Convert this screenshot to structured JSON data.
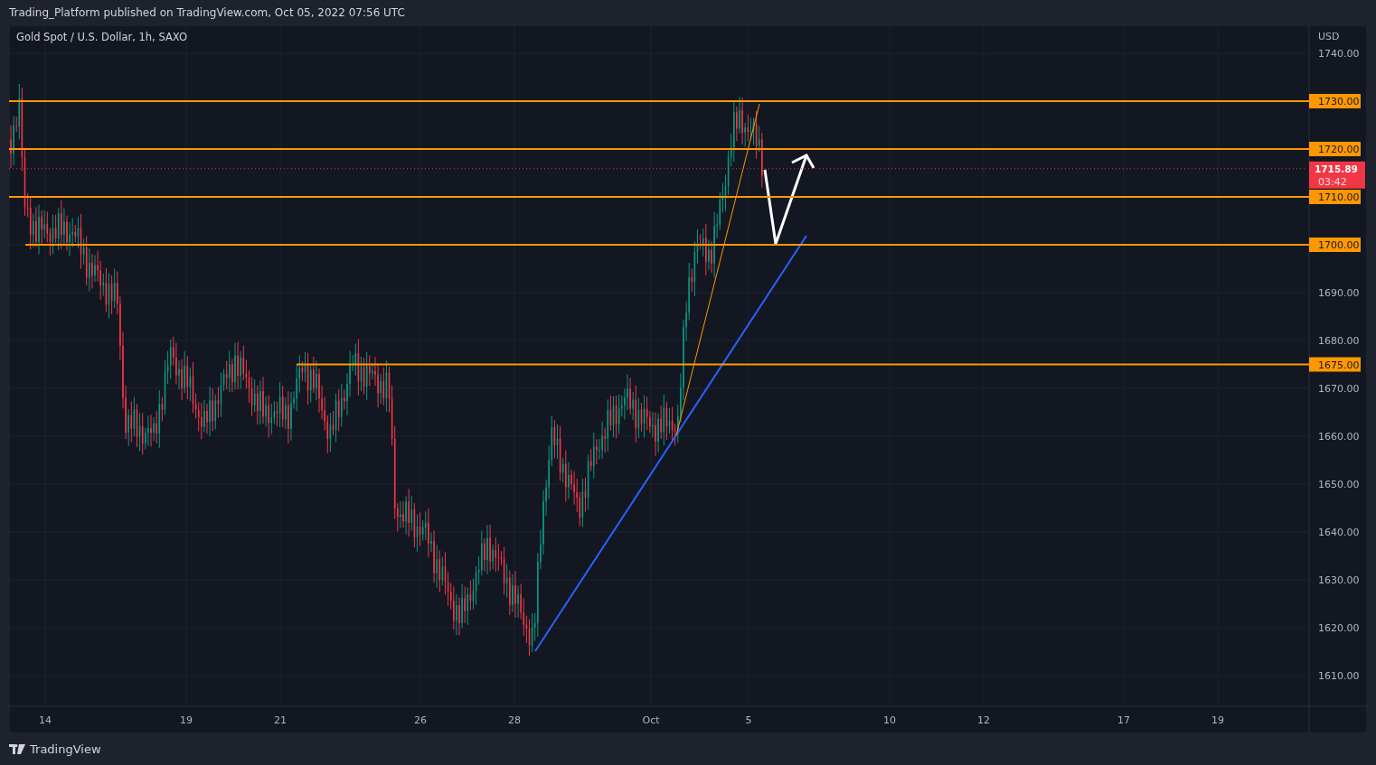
{
  "header": {
    "title": "Trading_Platform published on TradingView.com, Oct 05, 2022 07:56 UTC"
  },
  "chart": {
    "symbol": "Gold Spot / U.S. Dollar, 1h, SAXO",
    "currency": "USD",
    "price_ticks": [
      "1740.00",
      "1690.00",
      "1680.00",
      "1670.00",
      "1660.00",
      "1650.00",
      "1640.00",
      "1630.00",
      "1620.00",
      "1610.00"
    ],
    "levels": [
      {
        "label": "1730.00"
      },
      {
        "label": "1720.00"
      },
      {
        "label": "1710.00"
      },
      {
        "label": "1700.00"
      },
      {
        "label": "1675.00"
      }
    ],
    "last_price": {
      "price": "1715.89",
      "countdown": "03:42"
    },
    "date_ticks": [
      "14",
      "19",
      "21",
      "26",
      "28",
      "Oct",
      "5",
      "10",
      "12",
      "17",
      "19"
    ]
  },
  "footer": {
    "brand": "TradingView"
  }
}
